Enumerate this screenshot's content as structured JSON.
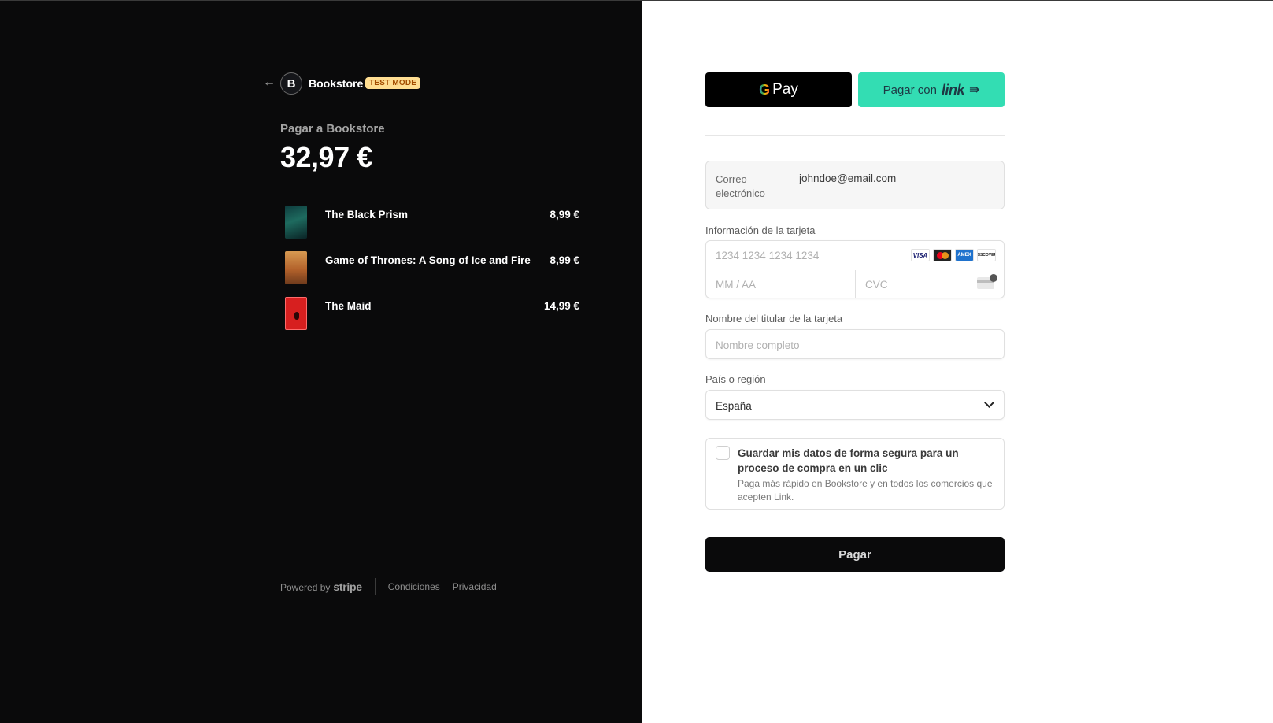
{
  "merchant": {
    "logo_letter": "B",
    "name": "Bookstore",
    "test_badge": "TEST MODE",
    "back_icon": "arrow-left-icon"
  },
  "summary": {
    "pay_to": "Pagar a Bookstore",
    "total": "32,97 €"
  },
  "line_items": [
    {
      "name": "The Black Prism",
      "price": "8,99 €"
    },
    {
      "name": "Game of Thrones: A Song of Ice and Fire",
      "price": "8,99 €"
    },
    {
      "name": "The Maid",
      "price": "14,99 €"
    }
  ],
  "footer": {
    "powered_by": "Powered by",
    "stripe": "stripe",
    "terms": "Condiciones",
    "privacy": "Privacidad"
  },
  "wallets": {
    "gpay_g": "G",
    "gpay_label": "Pay",
    "link_prefix": "Pagar con",
    "link_word": "link",
    "link_arrow": "⇛"
  },
  "email": {
    "label": "Correo electrónico",
    "value": "johndoe@email.com"
  },
  "card": {
    "label": "Información de la tarjeta",
    "number_placeholder": "1234 1234 1234 1234",
    "expiry_placeholder": "MM / AA",
    "cvc_placeholder": "CVC",
    "brands": [
      "VISA",
      "mastercard",
      "AMEX",
      "DISCOVER"
    ]
  },
  "cardholder": {
    "label": "Nombre del titular de la tarjeta",
    "placeholder": "Nombre completo"
  },
  "country": {
    "label": "País o región",
    "value": "España"
  },
  "save_info": {
    "title": "Guardar mis datos de forma segura para un proceso de compra en un clic",
    "subtitle": "Paga más rápido en Bookstore y en todos los comercios que acepten Link.",
    "checked": false
  },
  "submit": {
    "label": "Pagar"
  },
  "colors": {
    "left_bg": "#0a0a0b",
    "link_green": "#33ddb3",
    "badge_bg": "#ffde92",
    "badge_text": "#a34d00"
  }
}
